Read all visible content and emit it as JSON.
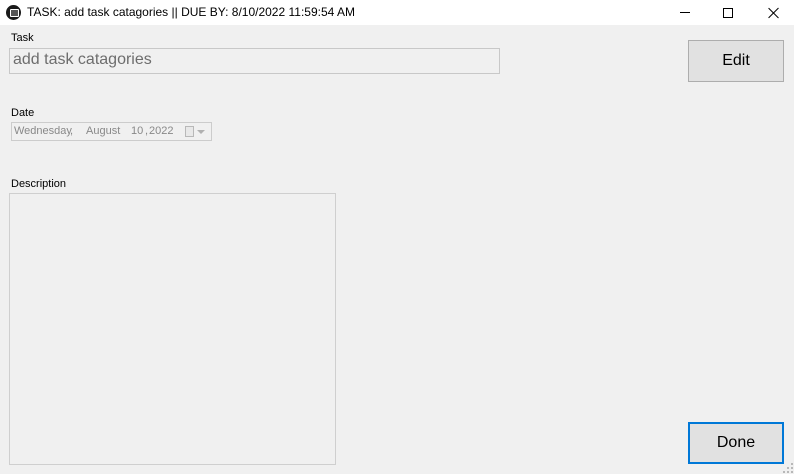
{
  "window": {
    "title": "TASK: add task catagories || DUE BY: 8/10/2022 11:59:54 AM",
    "controls": [
      "minimize",
      "maximize",
      "close"
    ]
  },
  "form": {
    "task_label": "Task",
    "task_value": "add task catagories",
    "date_label": "Date",
    "date": {
      "weekday": "Wednesday",
      "sep1": ",",
      "month": "August",
      "day": "10",
      "sep2": ",",
      "year": "2022"
    },
    "description_label": "Description",
    "description_value": ""
  },
  "buttons": {
    "edit_label": "Edit",
    "done_label": "Done"
  },
  "colors": {
    "background": "#f0f0f0",
    "titlebar": "#ffffff",
    "button_face": "#e1e1e1",
    "focus_border": "#0078d7",
    "disabled_text": "#6d6d6d"
  }
}
